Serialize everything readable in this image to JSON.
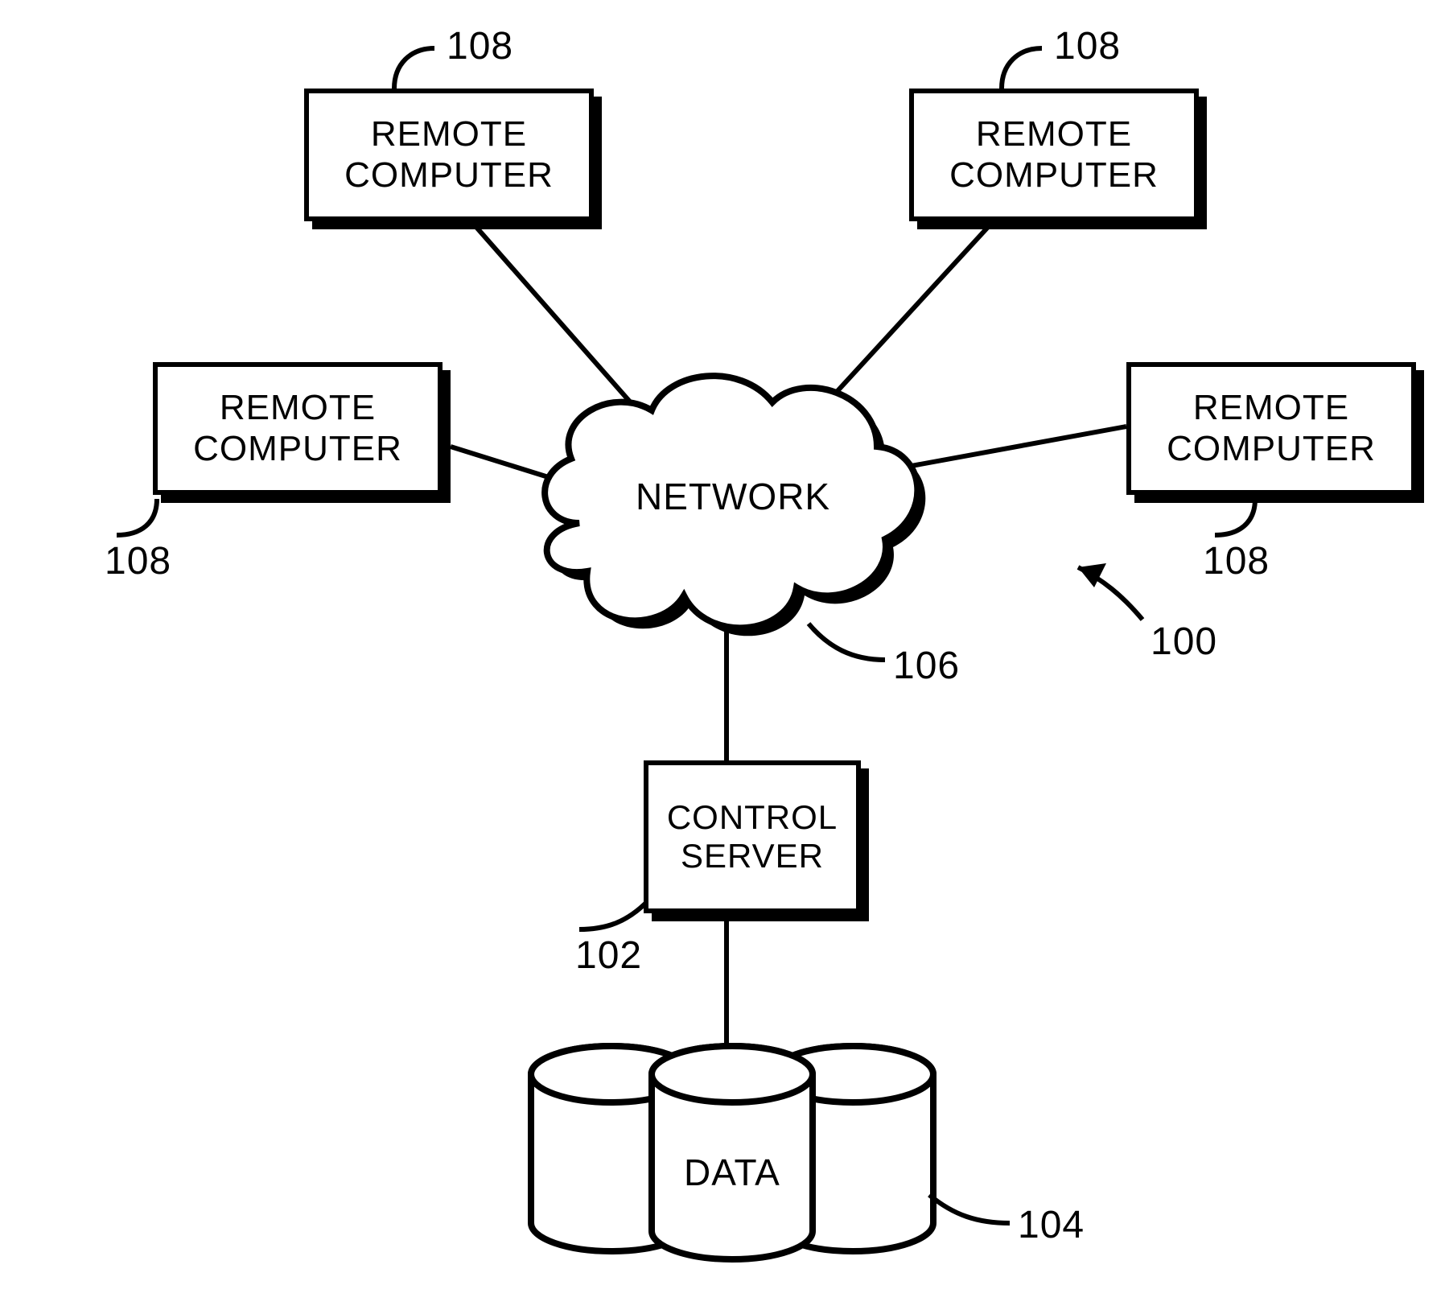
{
  "boxes": {
    "remote_top_left": {
      "line1": "REMOTE",
      "line2": "COMPUTER"
    },
    "remote_top_right": {
      "line1": "REMOTE",
      "line2": "COMPUTER"
    },
    "remote_mid_left": {
      "line1": "REMOTE",
      "line2": "COMPUTER"
    },
    "remote_mid_right": {
      "line1": "REMOTE",
      "line2": "COMPUTER"
    },
    "control_server": {
      "line1": "CONTROL",
      "line2": "SERVER"
    }
  },
  "cloud": {
    "label": "NETWORK"
  },
  "data_store": {
    "label": "DATA"
  },
  "refs": {
    "r108_tl": "108",
    "r108_tr": "108",
    "r108_ml": "108",
    "r108_mr": "108",
    "r106": "106",
    "r100": "100",
    "r102": "102",
    "r104": "104"
  }
}
